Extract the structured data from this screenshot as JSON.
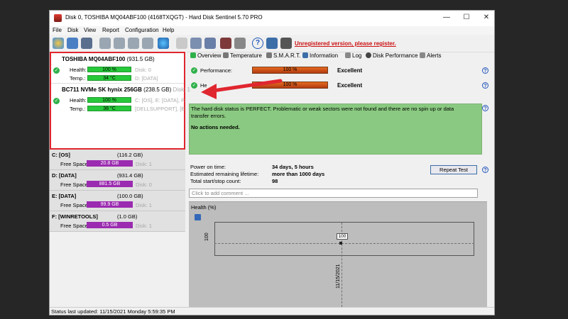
{
  "window": {
    "title": "Disk 0, TOSHIBA MQ04ABF100 (4168TXQGT) - Hard Disk Sentinel 5.70 PRO",
    "controls": {
      "minimize": "—",
      "maximize": "☐",
      "close": "✕"
    }
  },
  "menu": [
    "File",
    "Disk",
    "View",
    "Report",
    "Configuration",
    "Help"
  ],
  "toolbar": {
    "unregistered": "Unregistered version, please register."
  },
  "disks": [
    {
      "name": "TOSHIBA MQ04ABF100",
      "size": "(931.5 GB)",
      "health_label": "Health:",
      "health_value": "100 %",
      "health_disk": "Disk: 0",
      "temp_label": "Temp.:",
      "temp_value": "34 °C",
      "temp_info": "D: [DATA]"
    },
    {
      "name": "BC711 NVMe SK hynix 256GB",
      "size": "(238.5 GB)",
      "disk": "Disk: 1",
      "health_label": "Health:",
      "health_value": "100 %",
      "health_info": "C: [OS], E: [DATA], F:",
      "temp_label": "Temp.:",
      "temp_value": "38 °C",
      "temp_info": "[DELLSUPPORT], [E"
    }
  ],
  "volumes": [
    {
      "name": "C: [OS]",
      "size": "(116.2 GB)",
      "free_label": "Free Space",
      "free": "20.8 GB",
      "disk": "Disk: 1"
    },
    {
      "name": "D: [DATA]",
      "size": "(931.4 GB)",
      "free_label": "Free Space",
      "free": "881.5 GB",
      "disk": "Disk: 0"
    },
    {
      "name": "E: [DATA]",
      "size": "(100.0 GB)",
      "free_label": "Free Space",
      "free": "99.9 GB",
      "disk": "Disk: 1"
    },
    {
      "name": "F: [WINRETOOLS]",
      "size": "(1.0 GB)",
      "free_label": "Free Space",
      "free": "0.5 GB",
      "disk": "Disk: 1"
    }
  ],
  "tabs": [
    "Overview",
    "Temperature",
    "S.M.A.R.T.",
    "Information",
    "Log",
    "Disk Performance",
    "Alerts"
  ],
  "overview": {
    "performance_label": "Performance:",
    "performance_value": "100 %",
    "performance_rating": "Excellent",
    "health_label": "He",
    "health_value": "100 %",
    "health_rating": "Excellent",
    "status_text": "The hard disk status is PERFECT. Problematic or weak sectors were not found and there are no spin up or data transfer errors.",
    "actions": "No actions needed.",
    "power_on_label": "Power on time:",
    "power_on_value": "34 days, 5 hours",
    "lifetime_label": "Estimated remaining lifetime:",
    "lifetime_value": "more than 1000 days",
    "startstop_label": "Total start/stop count:",
    "startstop_value": "98",
    "repeat_button": "Repeat Test",
    "comment_placeholder": "Click to add comment ...",
    "graph_label": "Health (%)",
    "graph_y_label": "100",
    "graph_point_label": "100",
    "graph_x_label": "11/15/2021"
  },
  "statusbar": "Status last updated: 11/15/2021 Monday 5:59:35 PM",
  "colors": {
    "highlight_border": "#e0262f",
    "health_green": "#27c83a",
    "free_space_purple": "#9b2bb0",
    "status_green": "#8ac981"
  }
}
